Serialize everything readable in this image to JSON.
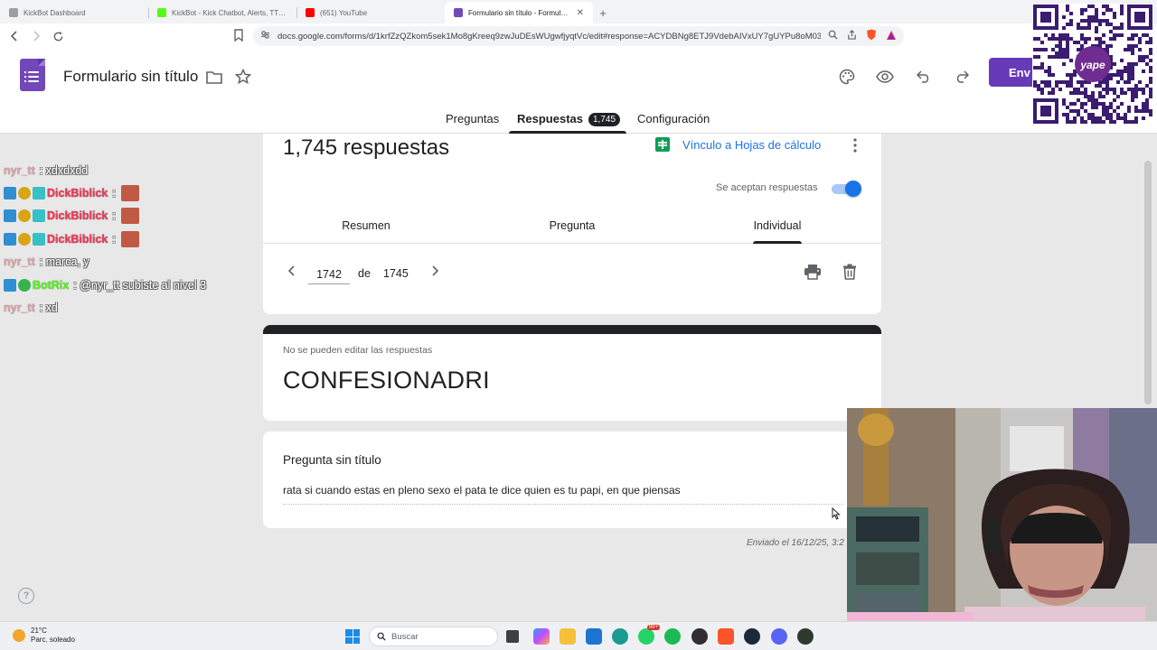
{
  "browser": {
    "tabs": [
      {
        "title": "KickBot Dashboard",
        "favicon_color": "#9e9e9e",
        "active": false
      },
      {
        "title": "KickBot - Kick Chatbot, Alerts, TTS, C",
        "favicon_color": "#53fc18",
        "active": false
      },
      {
        "title": "(651) YouTube",
        "favicon_color": "#ff0000",
        "active": false
      },
      {
        "title": "Formulario sin título - Formulario",
        "favicon_color": "#7248b9",
        "active": true
      }
    ],
    "new_tab": "+",
    "url": "docs.google.com/forms/d/1krfZzQZkom5sek1Mo8gKreeq9zwJuDEsWUgwfjyqtVc/edit#response=ACYDBNg8ETJ9VdebAIVxUY7gUYPu8oM03zK..."
  },
  "forms": {
    "title": "Formulario sin título",
    "send_label": "Env",
    "accent": "#673ab7",
    "tabs": {
      "questions": "Preguntas",
      "responses": "Respuestas",
      "responses_badge": "1,745",
      "settings": "Configuración"
    }
  },
  "summary": {
    "count_text": "1,745 respuestas",
    "sheets_link": "Vínculo a Hojas de cálculo",
    "accepting_label": "Se aceptan respuestas",
    "accepting_on": true,
    "view_tabs": [
      "Resumen",
      "Pregunta",
      "Individual"
    ],
    "active_view": "Individual",
    "pager": {
      "current": "1742",
      "of_label": "de",
      "total": "1745"
    }
  },
  "response": {
    "no_edit_notice": "No se pueden editar las respuestas",
    "form_title": "CONFESIONADRI",
    "question": "Pregunta sin título",
    "answer": "rata si cuando estas en pleno sexo el pata te dice quien es tu papi, en que piensas",
    "submitted": "Enviado el 16/12/25, 3:2"
  },
  "chat": [
    {
      "user": "nyr_tt",
      "style": "plain",
      "badges": [],
      "message": ": xdxdxdd",
      "emote": false
    },
    {
      "user": "DickBiblick",
      "style": "red",
      "badges": [
        "mod",
        "sub",
        "gift"
      ],
      "message": ":",
      "emote": true
    },
    {
      "user": "DickBiblick",
      "style": "red",
      "badges": [
        "mod",
        "sub",
        "gift"
      ],
      "message": ":",
      "emote": true
    },
    {
      "user": "DickBiblick",
      "style": "red",
      "badges": [
        "mod",
        "sub",
        "gift"
      ],
      "message": ":",
      "emote": true
    },
    {
      "user": "nyr_tt",
      "style": "plain",
      "badges": [],
      "message": ": marca, y",
      "emote": false
    },
    {
      "user": "BotRix",
      "style": "green",
      "badges": [
        "mod",
        "verified"
      ],
      "message": ": @nyr_tt subiste al nivel 3",
      "emote": false
    },
    {
      "user": "nyr_tt",
      "style": "plain",
      "badges": [],
      "message": ": xd",
      "emote": false
    }
  ],
  "qr_brand": "yape",
  "taskbar": {
    "temperature": "21°C",
    "weather": "Parc. soleado",
    "search_placeholder": "Buscar",
    "whatsapp_badge": "99+"
  }
}
